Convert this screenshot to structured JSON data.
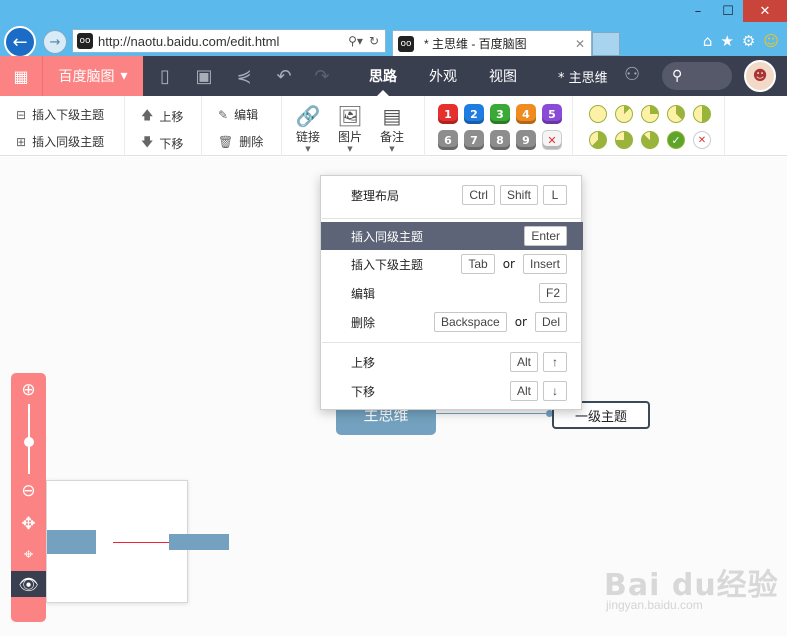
{
  "browser": {
    "url": "http://naotu.baidu.com/edit.html",
    "tab_title": "* 主思维 - 百度脑图",
    "site_icon": "oo",
    "window_buttons": [
      "–",
      "☐",
      "✕"
    ],
    "toolbar_icons": [
      "home-icon",
      "star-icon",
      "gear-icon",
      "smiley-icon"
    ]
  },
  "app": {
    "brand": "百度脑图",
    "tabs": [
      "思路",
      "外观",
      "视图"
    ],
    "active_tab": "思路",
    "doc_name": "* 主思维"
  },
  "ribbon": {
    "insert_child": "插入下级主题",
    "insert_sibling": "插入同级主题",
    "move_up": "上移",
    "move_down": "下移",
    "edit": "编辑",
    "delete": "删除",
    "link": "链接",
    "image": "图片",
    "note": "备注",
    "priorities": [
      "1",
      "2",
      "3",
      "4",
      "5",
      "6",
      "7",
      "8",
      "9"
    ],
    "priority_colors": [
      "#e5302e",
      "#1f7ce0",
      "#3aa935",
      "#f08b1f",
      "#8a4cd6",
      "#8d8d8d",
      "#8d8d8d",
      "#8d8d8d",
      "#8d8d8d"
    ]
  },
  "context_menu": {
    "arrange": {
      "label": "整理布局",
      "keys": [
        "Ctrl",
        "Shift",
        "L"
      ]
    },
    "insert_sibling": {
      "label": "插入同级主题",
      "keys": [
        "Enter"
      ]
    },
    "insert_child": {
      "label": "插入下级主题",
      "keys": [
        "Tab",
        "Insert"
      ],
      "or": "or"
    },
    "edit": {
      "label": "编辑",
      "keys": [
        "F2"
      ]
    },
    "delete": {
      "label": "删除",
      "keys": [
        "Backspace",
        "Del"
      ],
      "or": "or"
    },
    "move_up": {
      "label": "上移",
      "keys": [
        "Alt",
        "↑"
      ]
    },
    "move_down": {
      "label": "下移",
      "keys": [
        "Alt",
        "↓"
      ]
    }
  },
  "canvas": {
    "root_topic": "主思维",
    "child_topic": "一级主题"
  },
  "watermark": {
    "logo": "Bai du经验",
    "site": "jingyan.baidu.com"
  },
  "colors": {
    "accent": "#fc8383",
    "header": "#393f4f",
    "node": "#73a1bf",
    "menu_active": "#5e6477",
    "chrome": "#5bb9ec"
  }
}
